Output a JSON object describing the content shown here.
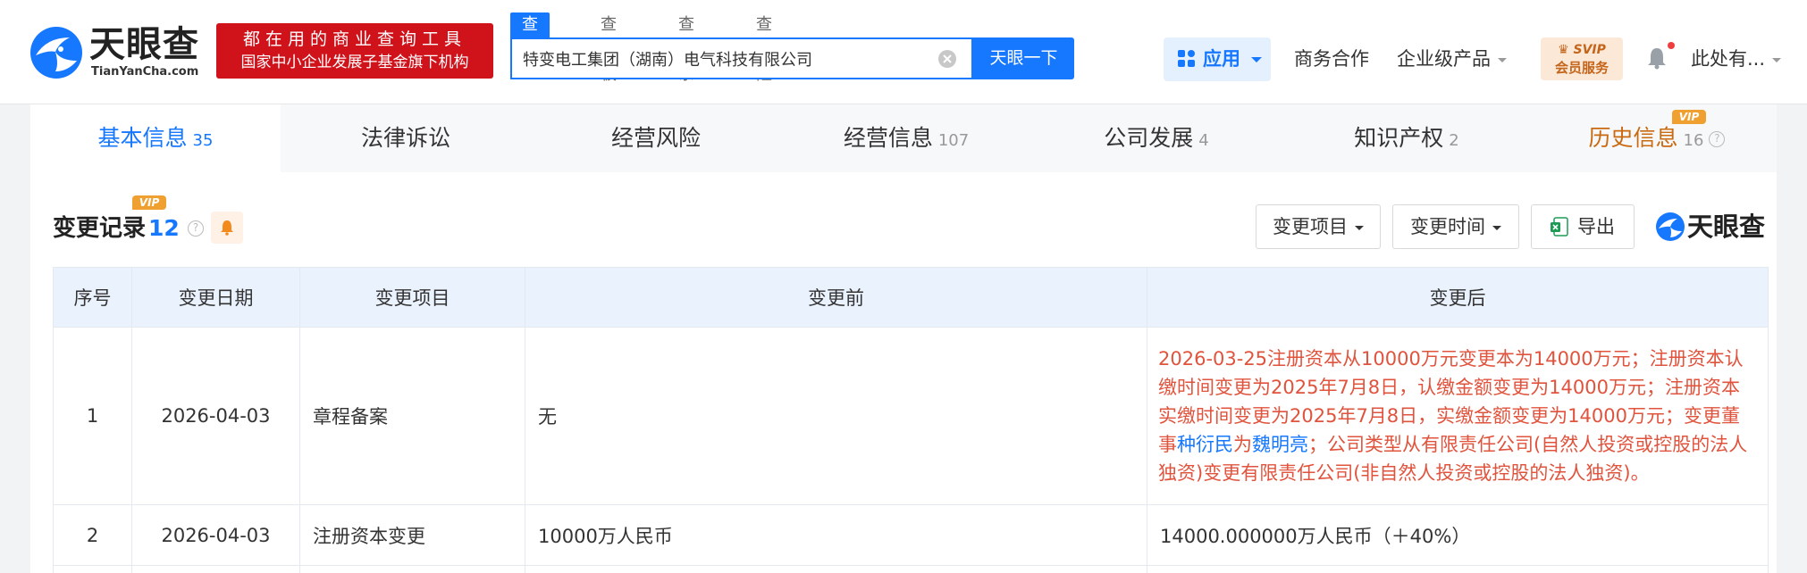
{
  "header": {
    "logo_cn": "天眼查",
    "logo_en": "TianYanCha.com",
    "slogan_line1": "都在用的商业查询工具",
    "slogan_line2": "国家中小企业发展子基金旗下机构",
    "search_tabs": [
      "查公司",
      "查老板",
      "查关系",
      "查风险"
    ],
    "search_value": "特变电工集团（湖南）电气科技有限公司",
    "search_button": "天眼一下",
    "app_label": "应用",
    "nav_business": "商务合作",
    "nav_enterprise": "企业级产品",
    "svip_top": "SVIP",
    "svip_bottom": "会员服务",
    "user_name": "此处有..."
  },
  "tabs": [
    {
      "label": "基本信息",
      "count": "35"
    },
    {
      "label": "法律诉讼",
      "count": ""
    },
    {
      "label": "经营风险",
      "count": ""
    },
    {
      "label": "经营信息",
      "count": "107"
    },
    {
      "label": "公司发展",
      "count": "4"
    },
    {
      "label": "知识产权",
      "count": "2"
    },
    {
      "label": "历史信息",
      "count": "16"
    }
  ],
  "vip_label": "VIP",
  "section": {
    "title": "变更记录",
    "count": "12",
    "filter_item": "变更项目",
    "filter_time": "变更时间",
    "export": "导出",
    "brand": "天眼查"
  },
  "table": {
    "headers": [
      "序号",
      "变更日期",
      "变更项目",
      "变更前",
      "变更后"
    ],
    "rows": [
      {
        "index": "1",
        "date": "2026-04-03",
        "item": "章程备案",
        "before": "无",
        "after_part1": "2026-03-25注册资本从10000万元变更本为14000万元；注册资本认缴时间变更为2025年7月8日，认缴金额变更为14000万元；注册资本实缴时间变更为2025年7月8日，实缴金额变更为14000万元；变更董事",
        "after_link1": "种衍民",
        "after_part2": "为",
        "after_link2": "魏明亮",
        "after_part3": "；公司类型从有限责任公司(自然人投资或控股的法人独资)变更有限责任公司(非自然人投资或控股的法人独资)。"
      },
      {
        "index": "2",
        "date": "2026-04-03",
        "item": "注册资本变更",
        "before": "10000万人民币",
        "after": "14000.000000万人民币（＋40%）"
      }
    ]
  },
  "colors": {
    "accent": "#1677ff",
    "brand_red": "#d0121b",
    "change_red": "#e0533d",
    "vip_orange": "#f0a030"
  }
}
